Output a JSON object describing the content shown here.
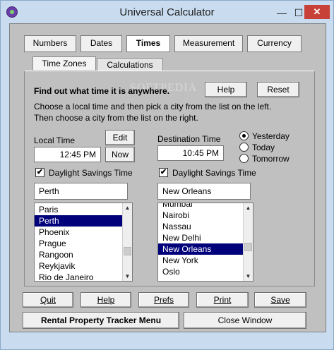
{
  "window": {
    "title": "Universal Calculator",
    "minimize": "—",
    "maximize": "☐",
    "close": "✕"
  },
  "tabs": [
    {
      "label": "Numbers",
      "active": false
    },
    {
      "label": "Dates",
      "active": false
    },
    {
      "label": "Times",
      "active": true
    },
    {
      "label": "Measurement",
      "active": false
    },
    {
      "label": "Currency",
      "active": false
    }
  ],
  "subtabs": [
    {
      "label": "Time Zones",
      "active": true
    },
    {
      "label": "Calculations",
      "active": false
    }
  ],
  "intro": {
    "heading": "Find out what time it is anywhere.",
    "line1": "Choose a local time and then pick a city from the list on the left.",
    "line2": "Then choose a city from the list on the right.",
    "help_label": "Help",
    "reset_label": "Reset",
    "watermark": "SOFTPEDIA"
  },
  "local": {
    "label": "Local Time",
    "time": "12:45 PM",
    "edit_label": "Edit",
    "now_label": "Now",
    "dst_label": "Daylight Savings Time",
    "dst_checked": true,
    "city": "Perth",
    "list": [
      "Paris",
      "Perth",
      "Phoenix",
      "Prague",
      "Rangoon",
      "Reykjavik",
      "Rio de Janeiro"
    ],
    "selected_index": 1
  },
  "destination": {
    "label": "Destination Time",
    "time": "10:45 PM",
    "day_options": [
      {
        "label": "Yesterday",
        "checked": true
      },
      {
        "label": "Today",
        "checked": false
      },
      {
        "label": "Tomorrow",
        "checked": false
      }
    ],
    "dst_label": "Daylight Savings Time",
    "dst_checked": true,
    "city": "New Orleans",
    "list": [
      "Mumbai",
      "Nairobi",
      "Nassau",
      "New Delhi",
      "New Orleans",
      "New York",
      "Oslo"
    ],
    "selected_index": 4
  },
  "bottom": {
    "quit_label": "Quit",
    "help_label": "Help",
    "prefs_label": "Prefs",
    "print_label": "Print",
    "save_label": "Save",
    "menu_label": "Rental Property Tracker Menu",
    "close_label": "Close Window"
  },
  "icons": {
    "app": "app-icon",
    "check": "✔",
    "scroll_up": "▲",
    "scroll_down": "▼"
  },
  "colors": {
    "selection": "#00007a",
    "window_frame": "#c9dcef",
    "close_button": "#c74138"
  }
}
